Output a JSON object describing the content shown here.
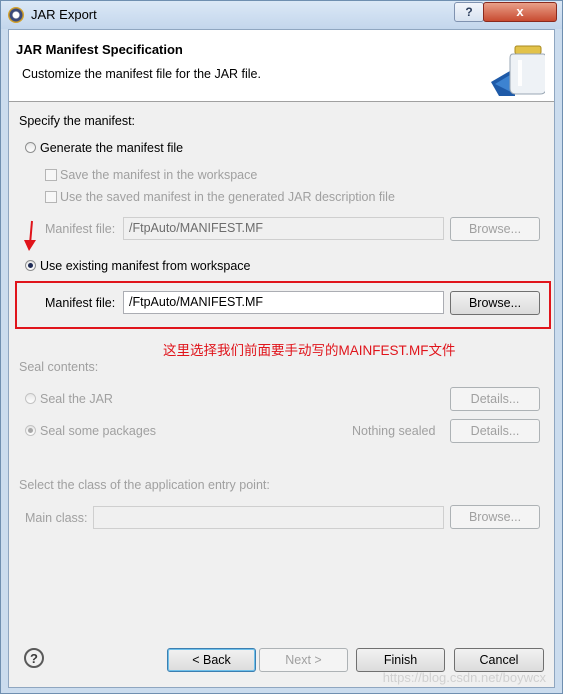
{
  "window": {
    "title": "JAR Export",
    "help_button": "?",
    "close_button": "x"
  },
  "banner": {
    "title": "JAR Manifest Specification",
    "description": "Customize the manifest file for the JAR file."
  },
  "manifest": {
    "section_label": "Specify the manifest:",
    "generate_option": "Generate the manifest file",
    "save_in_workspace": "Save the manifest in the workspace",
    "use_saved_in_description": "Use the saved manifest in the generated JAR description file",
    "generate_manifest_file_label": "Manifest file:",
    "generate_manifest_file_value": "/FtpAuto/MANIFEST.MF",
    "generate_browse": "Browse...",
    "use_existing_option": "Use existing manifest from workspace",
    "existing_manifest_file_label": "Manifest file:",
    "existing_manifest_file_value": "/FtpAuto/MANIFEST.MF",
    "existing_browse": "Browse..."
  },
  "annotation": {
    "text": "这里选择我们前面要手动写的MAINFEST.MF文件",
    "color": "#e0141b"
  },
  "seal": {
    "section_label": "Seal contents:",
    "seal_jar_option": "Seal the JAR",
    "seal_jar_details": "Details...",
    "seal_packages_option": "Seal some packages",
    "nothing_sealed": "Nothing sealed",
    "seal_packages_details": "Details..."
  },
  "entry_point": {
    "section_label": "Select the class of the application entry point:",
    "main_class_label": "Main class:",
    "main_class_value": "",
    "browse": "Browse..."
  },
  "footer": {
    "back": "< Back",
    "next": "Next >",
    "finish": "Finish",
    "cancel": "Cancel",
    "watermark": "https://blog.csdn.net/boywcx"
  }
}
